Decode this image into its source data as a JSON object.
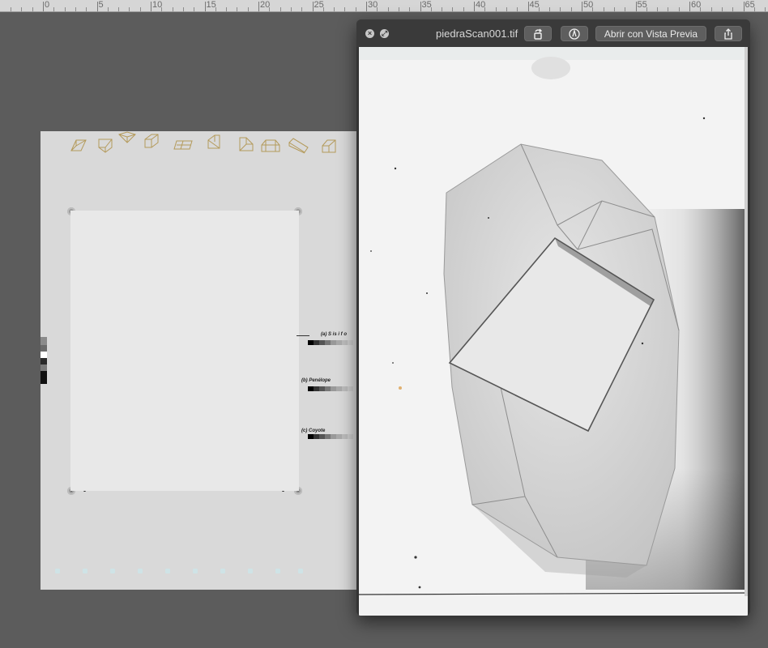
{
  "ruler": {
    "labels": [
      "0",
      "5",
      "10",
      "15",
      "20",
      "25",
      "30",
      "35",
      "40",
      "45",
      "50",
      "55",
      "60",
      "65"
    ]
  },
  "document": {
    "icons": [
      "cube-front-icon",
      "box-open-icon",
      "prism-top-icon",
      "cube-corner-icon",
      "slab-icon",
      "cube-split-icon",
      "cube-cut-icon",
      "house-prism-icon",
      "long-prism-icon",
      "tilted-cube-icon"
    ],
    "captions": {
      "a": "(a) S is  i f   o",
      "b": "(b) Penélope",
      "c": "(c) Coyote"
    }
  },
  "quicklook": {
    "title": "piedraScan001.tif",
    "buttons": {
      "rotate_icon": "rotate-icon",
      "markup_icon": "markup-icon",
      "open_label": "Abrir con Vista Previa",
      "share_icon": "share-icon"
    }
  },
  "colors": {
    "desktop": "#5c5c5c",
    "icon_gold": "#b49a5a",
    "window_bar": "#3a3a3a"
  }
}
